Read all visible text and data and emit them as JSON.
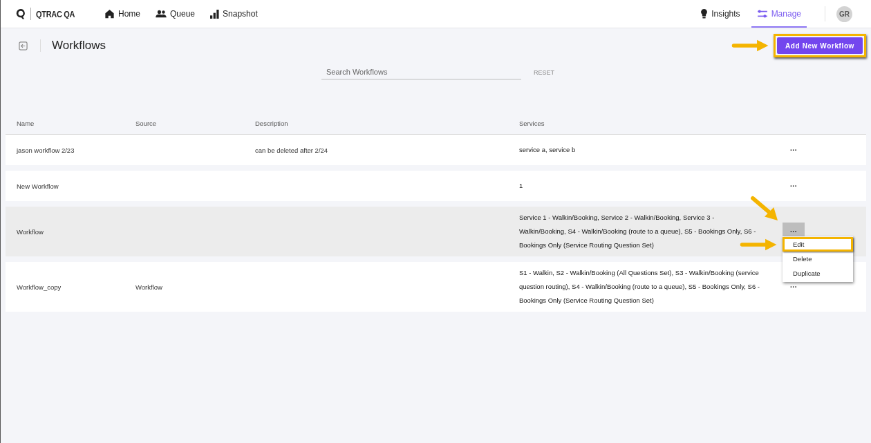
{
  "brand": {
    "name": "QTRAC QA"
  },
  "nav": [
    {
      "label": "Home",
      "kind": "home"
    },
    {
      "label": "Queue",
      "kind": "people"
    },
    {
      "label": "Snapshot",
      "kind": "bars"
    }
  ],
  "nav_right": [
    {
      "label": "Insights",
      "kind": "bulb",
      "selected": false
    },
    {
      "label": "Manage",
      "kind": "sliders",
      "selected": true
    }
  ],
  "avatar": "GR",
  "page": {
    "title": "Workflows",
    "add_button": "Add New Workflow"
  },
  "search": {
    "placeholder": "Search Workflows",
    "reset": "RESET"
  },
  "table": {
    "columns": [
      "Name",
      "Source",
      "Description",
      "Services"
    ],
    "rows": [
      {
        "name": "jason workflow 2/23",
        "source": "",
        "description": "can be deleted after 2/24",
        "services": "service a, service b",
        "selected": false,
        "menu_open": false
      },
      {
        "name": "New Workflow",
        "source": "",
        "description": "",
        "services": "1",
        "selected": false,
        "menu_open": false
      },
      {
        "name": "Workflow",
        "source": "",
        "description": "",
        "services": "Service 1 - Walkin/Booking, Service 2 - Walkin/Booking, Service 3 - Walkin/Booking, S4 - Walkin/Booking (route to a queue), S5 - Bookings Only, S6 - Bookings Only (Service Routing Question Set)",
        "selected": true,
        "menu_open": true
      },
      {
        "name": "Workflow_copy",
        "source": "Workflow",
        "description": "",
        "services": "S1 - Walkin, S2 - Walkin/Booking (All Questions Set), S3 - Walkin/Booking (service question routing), S4 - Walkin/Booking (route to a queue), S5 - Bookings Only, S6 - Bookings Only (Service Routing Question Set)",
        "selected": false,
        "menu_open": false
      }
    ],
    "actions_label": "···"
  },
  "row_menu": [
    {
      "label": "Edit",
      "highlighted": true
    },
    {
      "label": "Delete",
      "highlighted": false
    },
    {
      "label": "Duplicate",
      "highlighted": false
    }
  ]
}
